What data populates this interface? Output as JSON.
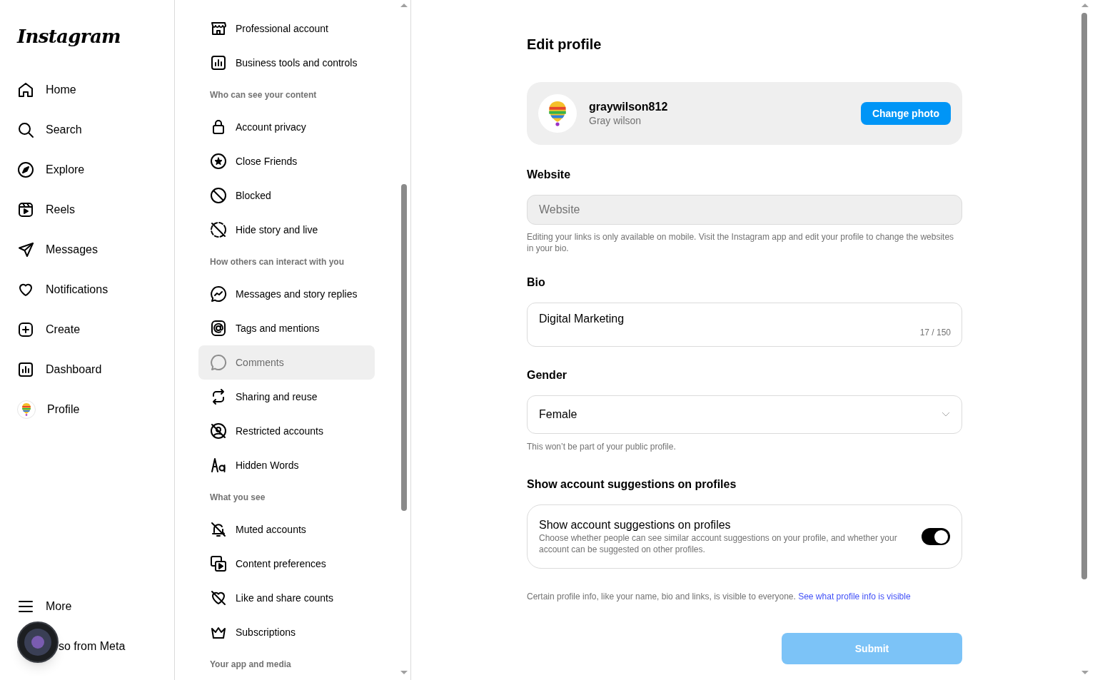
{
  "nav": {
    "logo": "Instagram",
    "items": [
      {
        "label": "Home",
        "selected": false
      },
      {
        "label": "Search",
        "selected": false
      },
      {
        "label": "Explore",
        "selected": false
      },
      {
        "label": "Reels",
        "selected": false
      },
      {
        "label": "Messages",
        "selected": false
      },
      {
        "label": "Notifications",
        "selected": false
      },
      {
        "label": "Create",
        "selected": false
      },
      {
        "label": "Dashboard",
        "selected": false
      },
      {
        "label": "Profile",
        "selected": false
      }
    ],
    "bottom": [
      {
        "label": "More"
      },
      {
        "label": "so from Meta"
      }
    ]
  },
  "settings_menu": {
    "sections": [
      {
        "items": [
          {
            "label": "Professional account",
            "selected": false
          },
          {
            "label": "Business tools and controls",
            "selected": false
          }
        ]
      },
      {
        "header": "Who can see your content",
        "items": [
          {
            "label": "Account privacy",
            "selected": false
          },
          {
            "label": "Close Friends",
            "selected": false
          },
          {
            "label": "Blocked",
            "selected": false
          },
          {
            "label": "Hide story and live",
            "selected": false
          }
        ]
      },
      {
        "header": "How others can interact with you",
        "items": [
          {
            "label": "Messages and story replies",
            "selected": false
          },
          {
            "label": "Tags and mentions",
            "selected": false
          },
          {
            "label": "Comments",
            "selected": true
          },
          {
            "label": "Sharing and reuse",
            "selected": false
          },
          {
            "label": "Restricted accounts",
            "selected": false
          },
          {
            "label": "Hidden Words",
            "selected": false
          }
        ]
      },
      {
        "header": "What you see",
        "items": [
          {
            "label": "Muted accounts",
            "selected": false
          },
          {
            "label": "Content preferences",
            "selected": false
          },
          {
            "label": "Like and share counts",
            "selected": false
          },
          {
            "label": "Subscriptions",
            "selected": false
          }
        ]
      },
      {
        "header": "Your app and media"
      }
    ]
  },
  "edit_profile": {
    "title": "Edit profile",
    "profile": {
      "username": "graywilson812",
      "full_name": "Gray wilson",
      "button": "Change photo"
    },
    "website": {
      "label": "Website",
      "placeholder": "Website",
      "help": "Editing your links is only available on mobile. Visit the Instagram app and edit your profile to change the websites in your bio."
    },
    "bio": {
      "label": "Bio",
      "value": "Digital Marketing",
      "counter": "17 / 150"
    },
    "gender": {
      "label": "Gender",
      "value": "Female",
      "help": "This won’t be part of your public profile."
    },
    "suggestions": {
      "heading": "Show account suggestions on profiles",
      "title": "Show account suggestions on profiles",
      "description": "Choose whether people can see similar account suggestions on your profile, and whether your account can be suggested on other profiles.",
      "on": true
    },
    "footer": {
      "text": "Certain profile info, like your name, bio and links, is visible to everyone.",
      "link": "See what profile info is visible"
    },
    "submit": {
      "label": "Submit",
      "disabled": true
    }
  }
}
